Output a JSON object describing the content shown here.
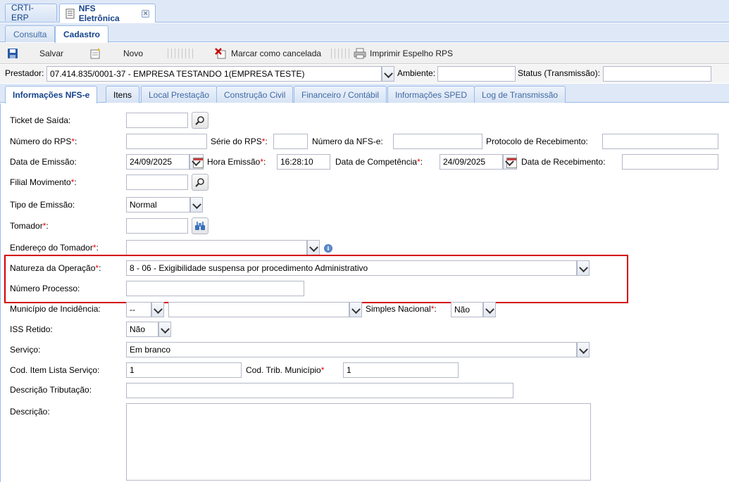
{
  "window_tabs": [
    {
      "label": "CRTI-ERP"
    },
    {
      "label": "NFS Eletrônica"
    }
  ],
  "sub_tabs": [
    {
      "label": "Consulta"
    },
    {
      "label": "Cadastro"
    }
  ],
  "toolbar": {
    "save_label": "Salvar",
    "new_label": "Novo",
    "cancel_label": "Marcar como cancelada",
    "print_label": "Imprimir Espelho RPS"
  },
  "prestador": {
    "label": "Prestador:",
    "value": "07.414.835/0001-37 - EMPRESA TESTANDO 1(EMPRESA TESTE)",
    "ambiente_label": "Ambiente:",
    "ambiente_value": "",
    "status_label": "Status (Transmissão):",
    "status_value": ""
  },
  "inner_tabs": [
    {
      "label": "Informações NFS-e"
    },
    {
      "label": "Itens"
    },
    {
      "label": "Local Prestação"
    },
    {
      "label": "Construção Civil"
    },
    {
      "label": "Financeiro / Contábil"
    },
    {
      "label": "Informações SPED"
    },
    {
      "label": "Log de Transmissão"
    }
  ],
  "form": {
    "ticket_label": "Ticket de Saída:",
    "ticket_value": "",
    "numero_rps_label": "Número do RPS",
    "numero_rps_value": "",
    "serie_rps_label": "Série do RPS",
    "serie_rps_value": "",
    "numero_nfse_label": "Número da NFS-e:",
    "numero_nfse_value": "",
    "protocolo_label": "Protocolo de Recebimento:",
    "protocolo_value": "",
    "data_emissao_label": "Data de Emissão:",
    "data_emissao_value": "24/09/2025",
    "hora_emissao_label": "Hora Emissão",
    "hora_emissao_value": "16:28:10",
    "data_competencia_label": "Data de Competência",
    "data_competencia_value": "24/09/2025",
    "data_recebimento_label": "Data de Recebimento:",
    "data_recebimento_value": "",
    "filial_label": "Filial Movimento",
    "filial_value": "",
    "tipo_emissao_label": "Tipo de Emissão:",
    "tipo_emissao_value": "Normal",
    "tomador_label": "Tomador",
    "tomador_value": "",
    "endereco_label": "Endereço do Tomador",
    "endereco_value": "",
    "natureza_label": "Natureza da Operação",
    "natureza_value": "8 - 06 - Exigibilidade suspensa por procedimento Administrativo",
    "numero_processo_label": "Número Processo:",
    "numero_processo_value": "",
    "municipio_label": "Município de Incidência:",
    "municipio_uf_value": "--",
    "municipio_value": "",
    "simples_label": "Simples Nacional",
    "simples_value": "Não",
    "iss_label": "ISS Retido:",
    "iss_value": "Não",
    "servico_label": "Serviço:",
    "servico_value": "Em branco",
    "cod_item_label": "Cod. Item Lista Serviço:",
    "cod_item_value": "1",
    "cod_trib_label": "Cod. Trib. Município",
    "cod_trib_value": "1",
    "desc_trib_label": "Descrição Tributação:",
    "desc_trib_value": "",
    "descricao_label": "Descrição:",
    "required_mark": "*",
    "colon": ":"
  },
  "colors": {
    "tab_bg": "#dfe8f6",
    "tab_border": "#99bbe8",
    "tab_text": "#15428b",
    "highlight": "#d40000",
    "required": "#ee0000"
  }
}
